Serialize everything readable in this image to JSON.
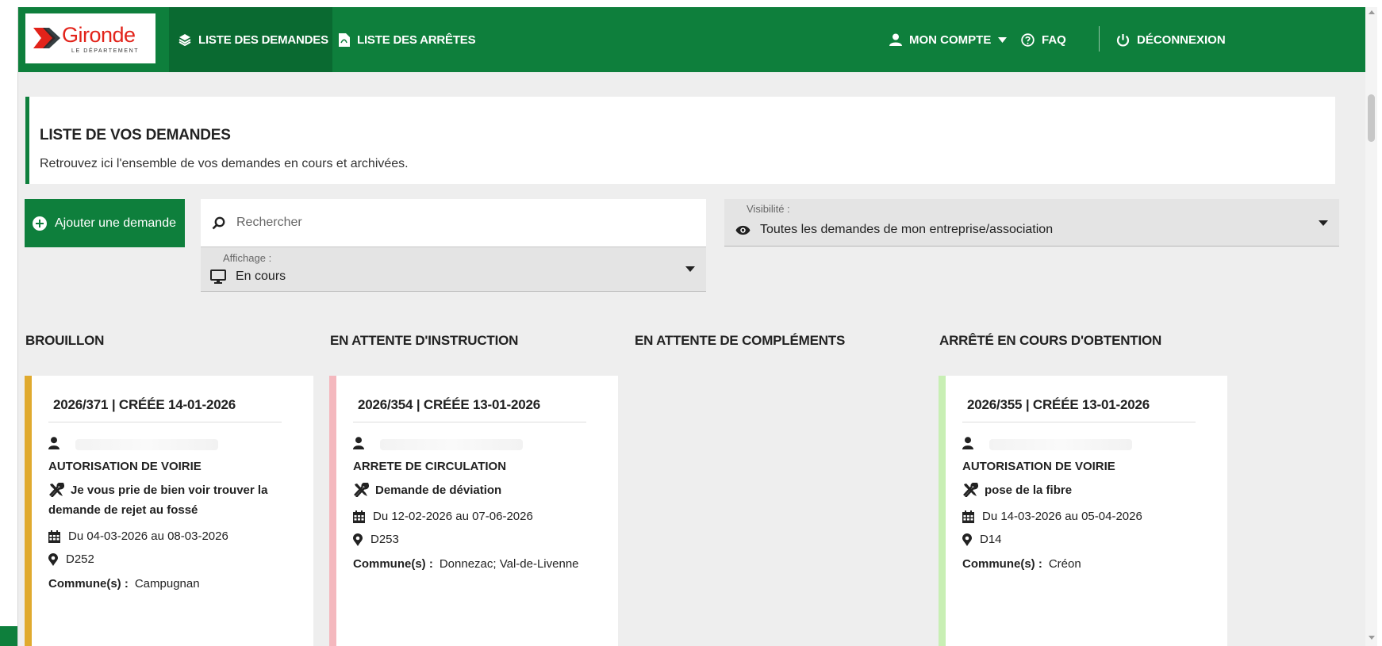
{
  "colors": {
    "brand_green": "#0e7f3c",
    "draft_yellow": "#e0aa2e",
    "pending_pink": "#f4b8be",
    "obtaining_green": "#c8efb4",
    "logo_red": "#e2231a"
  },
  "logo": {
    "name": "Gironde",
    "subtitle": "LE DÉPARTEMENT"
  },
  "navbar": {
    "links": [
      {
        "label": "LISTE DES DEMANDES",
        "icon": "layers-icon",
        "active": true
      },
      {
        "label": "LISTE DES ARRÊTES",
        "icon": "pdf-file-icon",
        "active": false
      }
    ],
    "account_label": "MON COMPTE",
    "faq_label": "FAQ",
    "logout_label": "DÉCONNEXION"
  },
  "header": {
    "title": "LISTE DE VOS DEMANDES",
    "subtitle": "Retrouvez ici l'ensemble de vos demandes en cours et archivées."
  },
  "controls": {
    "add_button_label": "Ajouter une demande",
    "search_placeholder": "Rechercher",
    "visibility": {
      "label": "Visibilité :",
      "value": "Toutes les demandes de mon entreprise/association"
    },
    "display": {
      "label": "Affichage :",
      "value": "En cours"
    }
  },
  "columns": [
    {
      "title": "BROUILLON",
      "cards": [
        {
          "ref": "2026/371 | CRÉÉE 14-01-2026",
          "type": "AUTORISATION DE VOIRIE",
          "object": "Je vous prie de bien voir trouver la demande de rejet au fossé",
          "dates": "Du 04-03-2026 au 08-03-2026",
          "road": "D252",
          "commune_label": "Commune(s) :",
          "commune": "Campugnan"
        }
      ]
    },
    {
      "title": "EN ATTENTE D'INSTRUCTION",
      "cards": [
        {
          "ref": "2026/354 | CRÉÉE 13-01-2026",
          "type": "ARRETE DE CIRCULATION",
          "object": "Demande de déviation",
          "dates": "Du 12-02-2026 au 07-06-2026",
          "road": "D253",
          "commune_label": "Commune(s) :",
          "commune": "Donnezac; Val-de-Livenne"
        }
      ]
    },
    {
      "title": "EN ATTENTE DE COMPLÉMENTS",
      "cards": []
    },
    {
      "title": "ARRÊTÉ EN COURS D'OBTENTION",
      "cards": [
        {
          "ref": "2026/355 | CRÉÉE 13-01-2026",
          "type": "AUTORISATION DE VOIRIE",
          "object": "pose de la fibre",
          "dates": "Du 14-03-2026 au 05-04-2026",
          "road": "D14",
          "commune_label": "Commune(s) :",
          "commune": "Créon"
        }
      ]
    }
  ]
}
